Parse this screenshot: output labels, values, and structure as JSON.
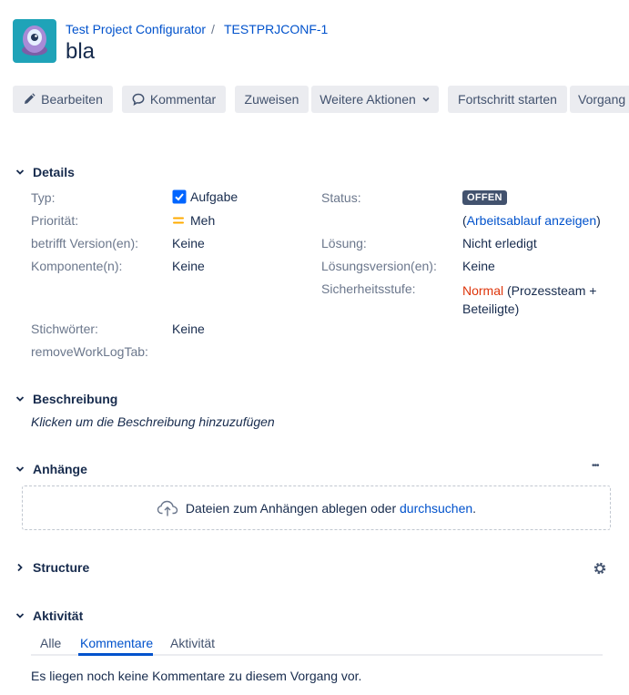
{
  "header": {
    "project": "Test Project Configurator",
    "issue_key": "TESTPRJCONF-1",
    "separator": "/",
    "title": "bla"
  },
  "toolbar": {
    "edit": "Bearbeiten",
    "comment": "Kommentar",
    "assign": "Zuweisen",
    "more": "Weitere Aktionen",
    "start_progress": "Fortschritt starten",
    "workflow": "Vorgang"
  },
  "details": {
    "heading": "Details",
    "type_label": "Typ:",
    "type_value": "Aufgabe",
    "priority_label": "Priorität:",
    "priority_value": "Meh",
    "affects_label": "betrifft Version(en):",
    "affects_value": "Keine",
    "components_label": "Komponente(n):",
    "components_value": "Keine",
    "labels_label": "Stichwörter:",
    "labels_value": "Keine",
    "removeworklog_label": "removeWorkLogTab:",
    "status_label": "Status:",
    "status_value": "OFFEN",
    "workflow_open": "(",
    "workflow_link": "Arbeitsablauf anzeigen",
    "workflow_close": ")",
    "resolution_label": "Lösung:",
    "resolution_value": "Nicht erledigt",
    "fixversion_label": "Lösungsversion(en):",
    "fixversion_value": "Keine",
    "security_label": "Sicherheitsstufe:",
    "security_level": "Normal",
    "security_rest_1": " (Prozessteam +",
    "security_rest_2": "Beteiligte)"
  },
  "description": {
    "heading": "Beschreibung",
    "placeholder": "Klicken um die Beschreibung hinzuzufügen"
  },
  "attachments": {
    "heading": "Anhänge",
    "more": "•••",
    "drop_text": "Dateien zum Anhängen ablegen oder",
    "browse_link": "durchsuchen",
    "period": "."
  },
  "structure": {
    "heading": "Structure"
  },
  "activity": {
    "heading": "Aktivität",
    "tabs": [
      "Alle",
      "Kommentare",
      "Aktivität"
    ],
    "active_tab": "Kommentare",
    "empty": "Es liegen noch keine Kommentare zu diesem Vorgang vor."
  },
  "colors": {
    "link": "#0052cc",
    "security_red": "#de350b",
    "priority_orange": "#ffab00",
    "checkbox_blue": "#0065ff",
    "avatar_teal": "#1fa3b8"
  }
}
